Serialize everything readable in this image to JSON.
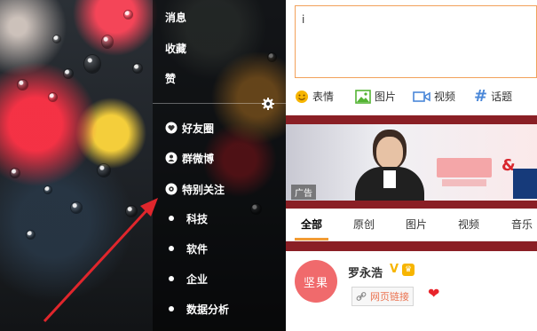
{
  "sidebar": {
    "top_items": [
      {
        "label": "消息"
      },
      {
        "label": "收藏"
      },
      {
        "label": "赞"
      }
    ],
    "groups": [
      {
        "label": "好友圈",
        "icon": "heart-circle-icon"
      },
      {
        "label": "群微博",
        "icon": "user-circle-icon"
      },
      {
        "label": "特别关注",
        "icon": "eye-circle-icon"
      },
      {
        "label": "科技"
      },
      {
        "label": "软件"
      },
      {
        "label": "企业"
      },
      {
        "label": "数据分析"
      }
    ]
  },
  "compose": {
    "text_value": "i",
    "tools": [
      {
        "label": "表情",
        "icon": "smile-icon"
      },
      {
        "label": "图片",
        "icon": "image-icon"
      },
      {
        "label": "视频",
        "icon": "video-icon"
      },
      {
        "label": "话题",
        "icon": "hashtag-icon"
      }
    ]
  },
  "banner": {
    "ad_label": "广告"
  },
  "feed_tabs": {
    "tabs": [
      "全部",
      "原创",
      "图片",
      "视频",
      "音乐"
    ],
    "active_index": 0
  },
  "feed": {
    "avatar_text": "坚果",
    "username": "罗永浩",
    "verified_symbol": "V",
    "link_label": "网页链接"
  },
  "colors": {
    "accent_orange": "#f29b33",
    "link_red": "#eb7350",
    "arrow_red": "#e0262c"
  }
}
